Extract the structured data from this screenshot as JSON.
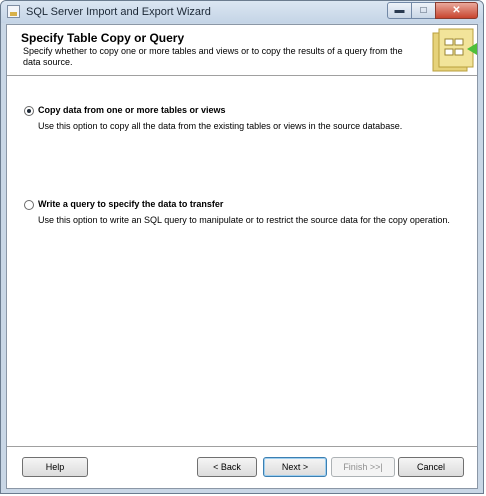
{
  "window": {
    "title": "SQL Server Import and Export Wizard",
    "controls": [
      "minimize-icon",
      "maximize-icon",
      "close-icon"
    ]
  },
  "header": {
    "title": "Specify Table Copy or Query",
    "description": "Specify whether to copy one or more tables and views or to copy the results of a query from the data source."
  },
  "options": [
    {
      "label": "Copy data from one or more tables or views",
      "description": "Use this option to copy all the data from the existing tables or views in the source database.",
      "selected": true
    },
    {
      "label": "Write a query to specify the data to transfer",
      "description": "Use this option to write an SQL query to manipulate or to restrict the source data for the copy operation.",
      "selected": false
    }
  ],
  "buttons": {
    "help": "Help",
    "back": "< Back",
    "next": "Next >",
    "finish": "Finish >>|",
    "cancel": "Cancel"
  },
  "button_states": {
    "finish_enabled": false,
    "next_focused": true
  },
  "colors": {
    "title_bar": "#c4d4e6",
    "close_button": "#c8452f",
    "wizard_icon_yellow": "#e6d27a",
    "wizard_icon_green": "#4fbf3a"
  }
}
